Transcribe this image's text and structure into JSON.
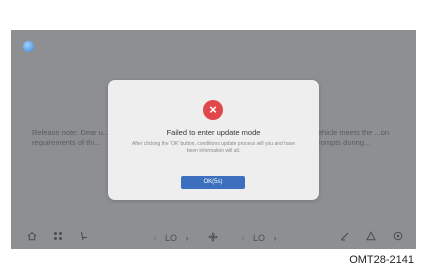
{
  "screen": {
    "app_icon": "app-circle-icon",
    "background_text_left": "Release note: Dear u... requirements of thi...",
    "background_text_right": "vehicle meets the ...on prompts during..."
  },
  "dialog": {
    "icon": "error-x-icon",
    "icon_color": "#e0474a",
    "title": "Failed to enter update mode",
    "description": "After clicking the 'OK' button, conditions update process will you and have been information will all.",
    "ok_label": "OK(5s)",
    "ok_color": "#3c6fbe"
  },
  "bottom_bar": {
    "home_icon": "home-icon",
    "apps_icon": "apps-grid-icon",
    "seat_icon": "seat-icon",
    "left_temp": "LO",
    "fan_icon": "fan-icon",
    "right_temp": "LO",
    "wiper_icon": "wiper-icon",
    "hazard_icon": "hazard-triangle-icon",
    "settings_icon": "target-icon"
  },
  "caption": "OMT28-2141"
}
